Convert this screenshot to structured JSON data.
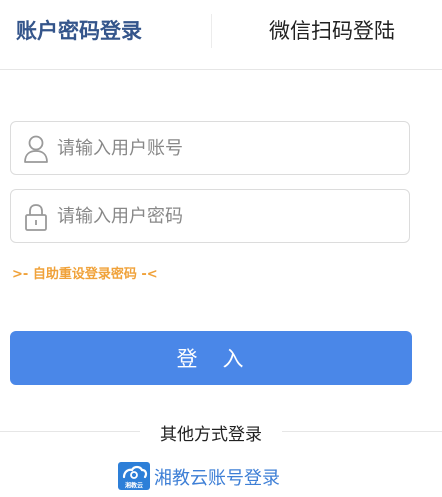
{
  "tabs": {
    "account_label": "账户密码登录",
    "wechat_label": "微信扫码登陆"
  },
  "form": {
    "username_placeholder": "请输入用户账号",
    "username_value": "",
    "password_placeholder": "请输入用户密码",
    "password_value": "",
    "reset_link": ">- 自助重设登录密码 -<",
    "login_button": "登　入"
  },
  "other": {
    "title": "其他方式登录",
    "xiangjiaoyun_label": "湘教云账号登录",
    "xiangjiaoyun_logo_text": "湘教云"
  },
  "colors": {
    "primary": "#4a87e8",
    "tab_active": "#34558b",
    "reset_link": "#f0a23a",
    "alt_link": "#3e7fd6"
  },
  "icons": {
    "username": "user-icon",
    "password": "lock-icon",
    "alt_login": "xiangjiaoyun-logo-icon"
  }
}
